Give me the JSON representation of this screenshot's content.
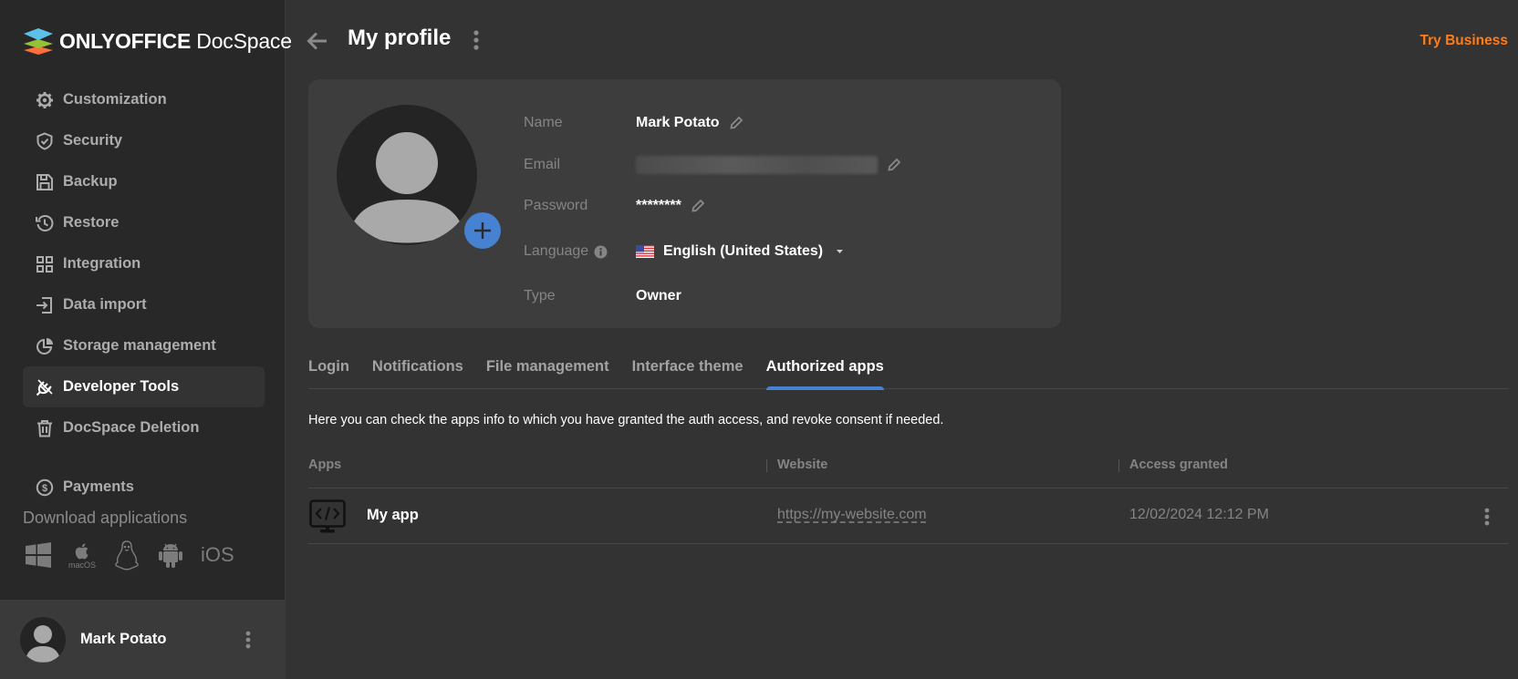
{
  "sidebar": {
    "logo": {
      "brand": "ONLYOFFICE",
      "product": " DocSpace"
    },
    "items": [
      {
        "label": "Customization",
        "icon": "gear-icon"
      },
      {
        "label": "Security",
        "icon": "shield-icon"
      },
      {
        "label": "Backup",
        "icon": "save-icon"
      },
      {
        "label": "Restore",
        "icon": "history-icon"
      },
      {
        "label": "Integration",
        "icon": "grid-icon"
      },
      {
        "label": "Data import",
        "icon": "import-icon"
      },
      {
        "label": "Storage management",
        "icon": "pie-chart-icon"
      },
      {
        "label": "Developer Tools",
        "icon": "plug-icon",
        "active": true
      },
      {
        "label": "DocSpace Deletion",
        "icon": "trash-icon"
      },
      {
        "label": "Payments",
        "icon": "dollar-icon"
      }
    ],
    "download": {
      "title": "Download applications",
      "apps": [
        "Windows",
        "macOS",
        "Linux",
        "Android",
        "iOS"
      ],
      "macos_label": "macOS",
      "ios_label": "iOS"
    },
    "user": {
      "name": "Mark Potato"
    }
  },
  "header": {
    "title": "My profile",
    "try_business": "Try Business"
  },
  "profile": {
    "fields": {
      "name": {
        "label": "Name",
        "value": "Mark Potato"
      },
      "email": {
        "label": "Email",
        "value": ""
      },
      "password": {
        "label": "Password",
        "value": "********"
      },
      "language": {
        "label": "Language",
        "value": "English (United States)"
      },
      "type": {
        "label": "Type",
        "value": "Owner"
      }
    }
  },
  "tabs": [
    {
      "label": "Login"
    },
    {
      "label": "Notifications"
    },
    {
      "label": "File management"
    },
    {
      "label": "Interface theme"
    },
    {
      "label": "Authorized apps",
      "active": true
    }
  ],
  "authorized_apps": {
    "description": "Here you can check the apps info to which you have granted the auth access, and revoke consent if needed.",
    "columns": [
      "Apps",
      "Website",
      "Access granted"
    ],
    "rows": [
      {
        "name": "My app",
        "website": "https://my-website.com",
        "access_granted": "12/02/2024 12:12 PM"
      }
    ]
  },
  "colors": {
    "accent": "#4781d1",
    "try_business": "#ff7c18",
    "sidebar_bg": "#282828",
    "main_bg": "#333333",
    "card_bg": "#3d3d3d"
  }
}
